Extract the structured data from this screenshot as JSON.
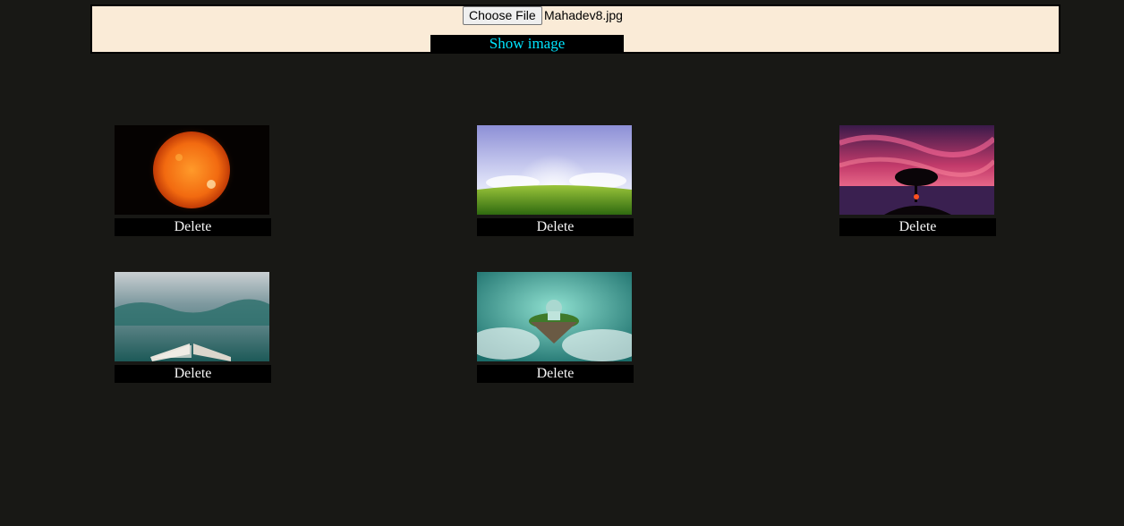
{
  "upload": {
    "choose_label": "Choose File",
    "file_name": "Mahadev8.jpg",
    "show_label": "Show image"
  },
  "gallery": {
    "items": [
      {
        "image": "sun",
        "delete_label": "Delete"
      },
      {
        "image": "green-meadow-sunrise",
        "delete_label": "Delete"
      },
      {
        "image": "tree-sunset",
        "delete_label": "Delete"
      },
      {
        "image": "open-book-ocean-waves",
        "delete_label": "Delete"
      },
      {
        "image": "floating-island-clouds",
        "delete_label": "Delete"
      }
    ]
  },
  "colors": {
    "page_background": "#181815",
    "panel_background": "#faebd7",
    "show_button_text": "#00e5ff"
  }
}
